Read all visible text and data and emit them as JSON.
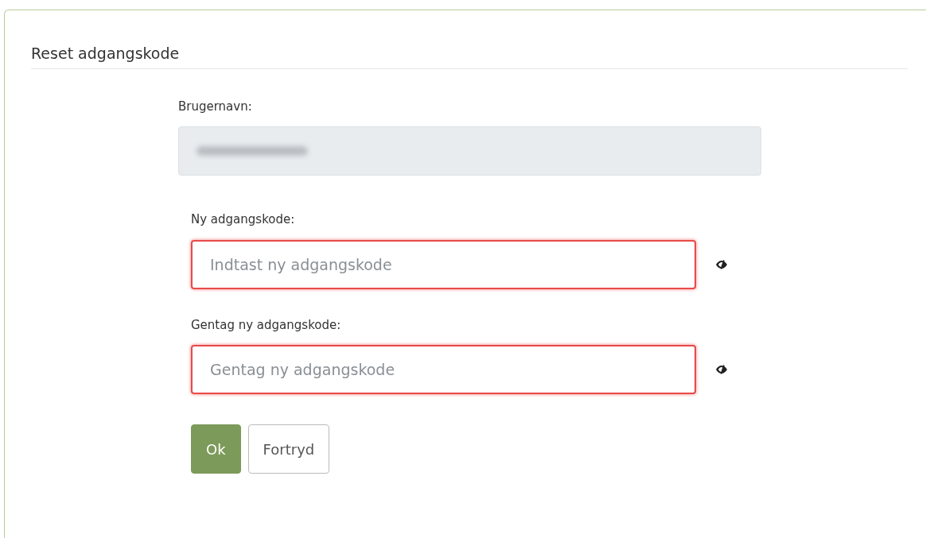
{
  "title": "Reset adgangskode",
  "username": {
    "label": "Brugernavn:",
    "disabled": true
  },
  "password_fields": [
    {
      "label": "Ny adgangskode:",
      "placeholder": "Indtast ny adgangskode",
      "invalid": true
    },
    {
      "label": "Gentag ny adgangskode:",
      "placeholder": "Gentag ny adgangskode",
      "invalid": true
    }
  ],
  "buttons": [
    {
      "label": "Ok",
      "kind": "primary"
    },
    {
      "label": "Fortryd",
      "kind": "secondary"
    }
  ]
}
